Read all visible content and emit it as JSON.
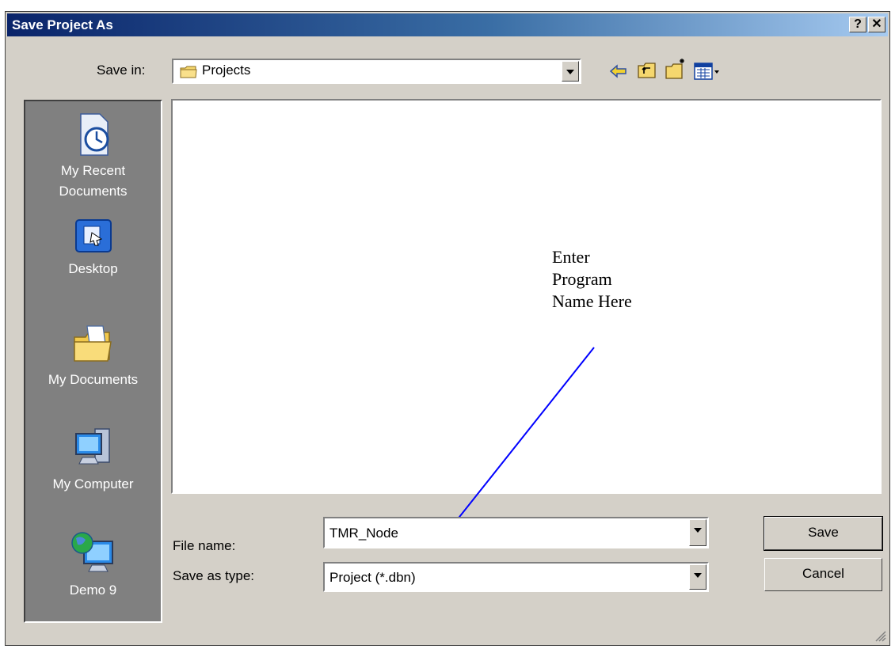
{
  "window": {
    "title": "Save Project As",
    "help_label": "?",
    "close_label": "✕"
  },
  "save_in": {
    "label": "Save in:",
    "value": "Projects"
  },
  "toolbar": {
    "back_icon": "back-arrow-icon",
    "up_icon": "up-folder-icon",
    "new_folder_icon": "new-folder-icon",
    "views_icon": "views-menu-icon"
  },
  "places": [
    {
      "label_line1": "My Recent",
      "label_line2": "Documents",
      "icon": "clock-document-icon"
    },
    {
      "label_line1": "Desktop",
      "label_line2": "",
      "icon": "desktop-icon"
    },
    {
      "label_line1": "My Documents",
      "label_line2": "",
      "icon": "folder-document-icon"
    },
    {
      "label_line1": "My Computer",
      "label_line2": "",
      "icon": "computer-icon"
    },
    {
      "label_line1": "Demo 9",
      "label_line2": "",
      "icon": "network-computer-icon"
    }
  ],
  "file_name": {
    "label": "File name:",
    "value": "TMR_Node"
  },
  "save_as_type": {
    "label": "Save as type:",
    "value": "Project (*.dbn)"
  },
  "buttons": {
    "save": "Save",
    "cancel": "Cancel"
  },
  "annotation": {
    "line1": "Enter",
    "line2": "Program",
    "line3": "Name Here"
  },
  "colors": {
    "title_gradient_start": "#0a246a",
    "title_gradient_end": "#a6caf0",
    "dialog_face": "#d4d0c8",
    "places_bar": "#808080",
    "annotation_arrow": "#0000ff"
  }
}
